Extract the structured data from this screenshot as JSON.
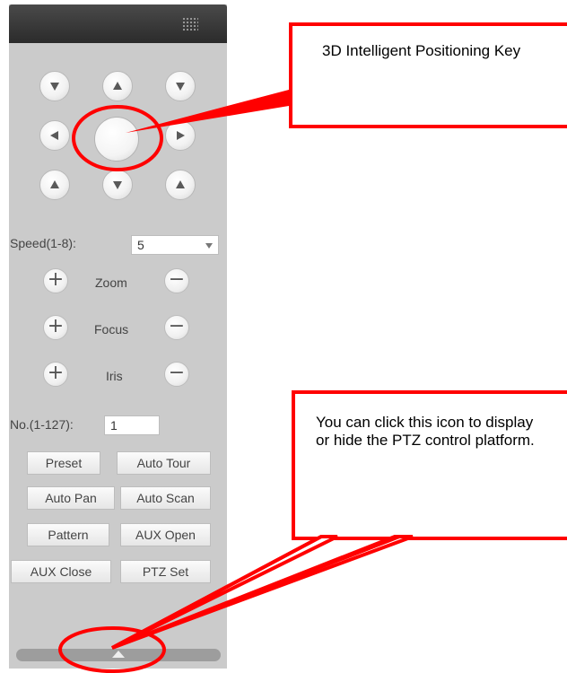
{
  "ptz_panel": {
    "direction_buttons": [
      {
        "name": "up-left"
      },
      {
        "name": "up"
      },
      {
        "name": "up-right"
      },
      {
        "name": "left"
      },
      {
        "name": "right"
      },
      {
        "name": "down-left"
      },
      {
        "name": "down"
      },
      {
        "name": "down-right"
      }
    ],
    "speed": {
      "label": "Speed(1-8):",
      "value": "5"
    },
    "zoom": {
      "label": "Zoom",
      "plus": "+",
      "minus": "−"
    },
    "focus": {
      "label": "Focus",
      "plus": "+",
      "minus": "−"
    },
    "iris": {
      "label": "Iris",
      "plus": "+",
      "minus": "−"
    },
    "number": {
      "label": "No.(1-127):",
      "value": "1"
    },
    "buttons": {
      "preset": "Preset",
      "auto_tour": "Auto Tour",
      "auto_pan": "Auto Pan",
      "auto_scan": "Auto Scan",
      "pattern": "Pattern",
      "aux_open": "AUX Open",
      "aux_close": "AUX Close",
      "ptz_set": "PTZ Set"
    }
  },
  "callouts": {
    "positioning_key": "3D Intelligent Positioning Key",
    "toggle_platform": "You can click this icon to display or hide the PTZ control platform."
  },
  "colors": {
    "callout_border": "#ff0000",
    "panel_bg": "#cbcbcb",
    "header_bg": "#2b2b2b"
  }
}
